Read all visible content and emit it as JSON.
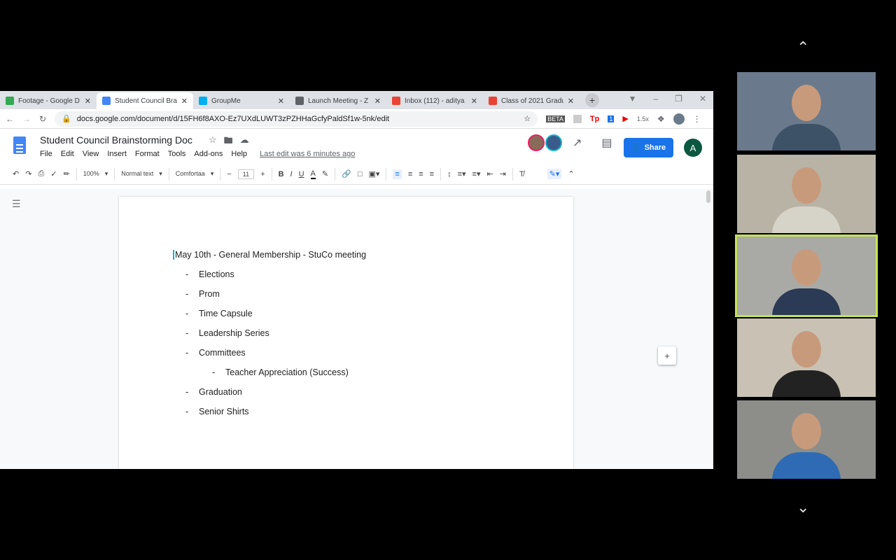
{
  "browser": {
    "tabs": [
      {
        "label": "Footage - Google D",
        "color": "#34a853"
      },
      {
        "label": "Student Council Bra",
        "color": "#4285f4",
        "active": true
      },
      {
        "label": "GroupMe",
        "color": "#00aff0"
      },
      {
        "label": "Launch Meeting - Z",
        "color": "#5f6368"
      },
      {
        "label": "Inbox (112) - aditya",
        "color": "#ea4335"
      },
      {
        "label": "Class of 2021 Gradu",
        "color": "#ea4335"
      }
    ],
    "url": "docs.google.com/document/d/15FH6f8AXO-Ez7UXdLUWT3zPZHHaGcfyPaldSf1w-5nk/edit",
    "ext_badge": "BETA",
    "ext_tp": "Tp",
    "ext_speed": "1.5x",
    "ext_count": "1"
  },
  "doc": {
    "title": "Student Council Brainstorming Doc",
    "menu": [
      "File",
      "Edit",
      "View",
      "Insert",
      "Format",
      "Tools",
      "Add-ons",
      "Help"
    ],
    "last_edit": "Last edit was 6 minutes ago",
    "share": "Share",
    "account_initial": "A",
    "toolbar": {
      "zoom": "100%",
      "style": "Normal text",
      "font": "Comfortaa",
      "size": "11"
    },
    "heading": "May 10th - General Membership - StuCo meeting",
    "items": [
      {
        "text": "Elections",
        "level": 1
      },
      {
        "text": "Prom",
        "level": 1
      },
      {
        "text": "Time Capsule",
        "level": 1
      },
      {
        "text": "Leadership Series",
        "level": 1
      },
      {
        "text": "Committees",
        "level": 1
      },
      {
        "text": "Teacher Appreciation (Success)",
        "level": 2
      },
      {
        "text": "Graduation",
        "level": 1
      },
      {
        "text": "Senior Shirts",
        "level": 1
      }
    ],
    "bullet": "-"
  },
  "participants": [
    {
      "bg": "#6a7a8c",
      "shirt": "#3d5266",
      "active": false
    },
    {
      "bg": "#b9b3a6",
      "shirt": "#d6d4c8",
      "active": false
    },
    {
      "bg": "#a9aaa6",
      "shirt": "#2b3a55",
      "active": true
    },
    {
      "bg": "#c9c2b4",
      "shirt": "#222",
      "active": false
    },
    {
      "bg": "#8d8e8a",
      "shirt": "#2e6bb4",
      "active": false
    }
  ]
}
